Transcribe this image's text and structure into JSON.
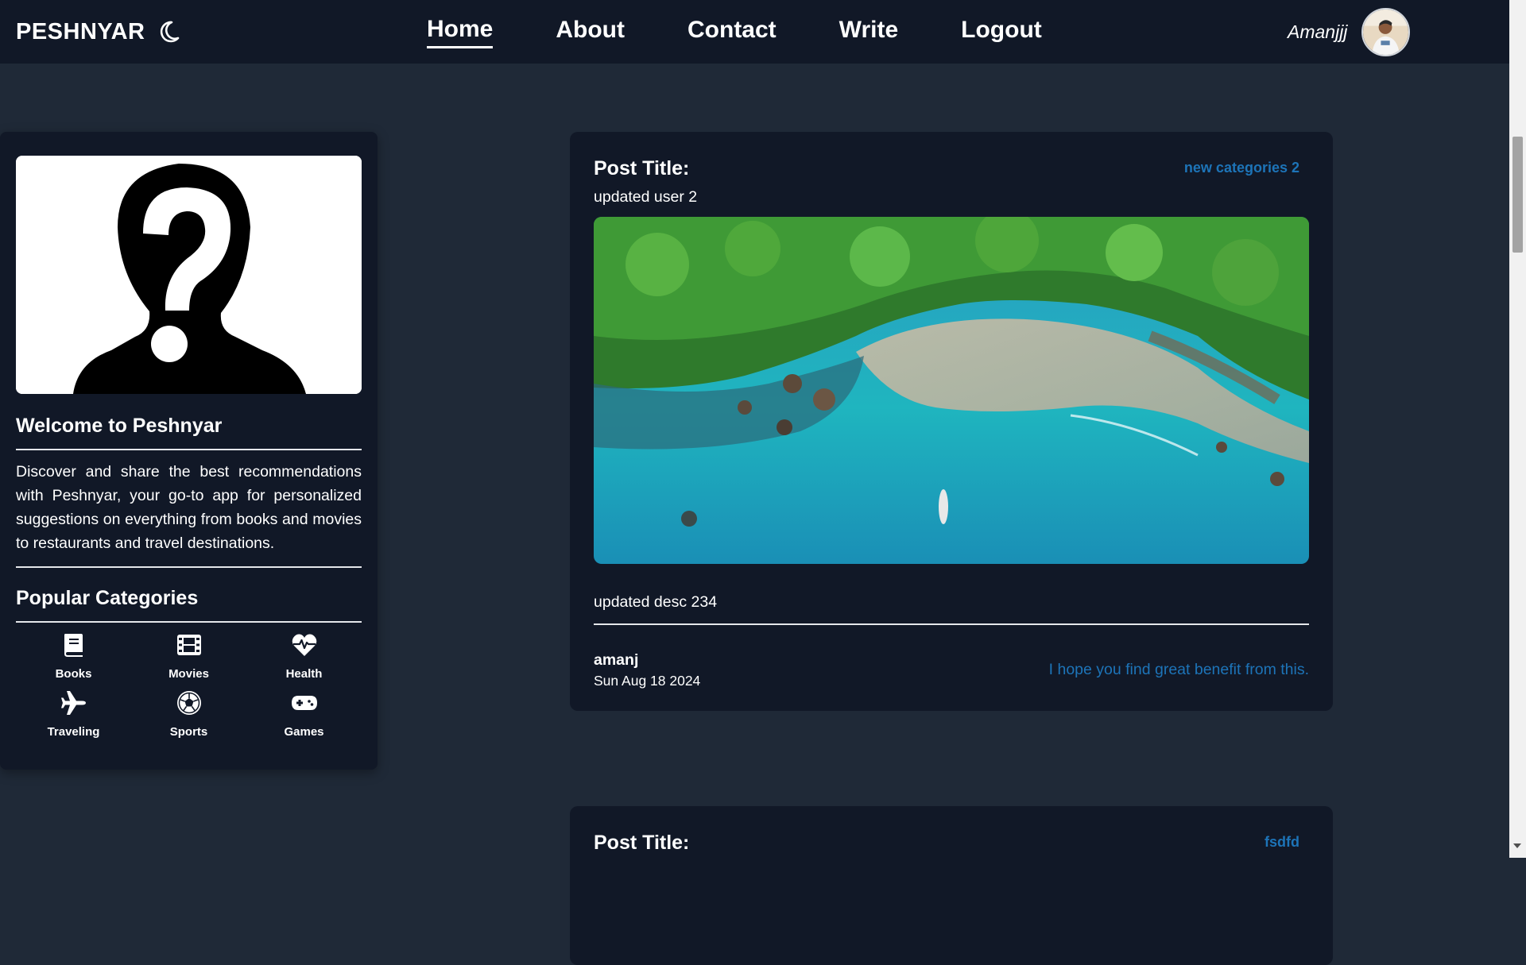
{
  "navbar": {
    "brand": "PESHNYAR",
    "theme_icon": "moon-icon",
    "links": [
      {
        "label": "Home",
        "active": true
      },
      {
        "label": "About",
        "active": false
      },
      {
        "label": "Contact",
        "active": false
      },
      {
        "label": "Write",
        "active": false
      },
      {
        "label": "Logout",
        "active": false
      }
    ],
    "username": "Amanjjj"
  },
  "sidebar": {
    "welcome_title": "Welcome to Peshnyar",
    "welcome_text": "Discover and share the best recommendations with Peshnyar, your go-to app for personalized suggestions on everything from books and movies to restaurants and travel destinations.",
    "categories_title": "Popular Categories",
    "categories": [
      {
        "label": "Books",
        "icon": "book-icon"
      },
      {
        "label": "Movies",
        "icon": "film-icon"
      },
      {
        "label": "Health",
        "icon": "heartbeat-icon"
      },
      {
        "label": "Traveling",
        "icon": "plane-icon"
      },
      {
        "label": "Sports",
        "icon": "soccer-ball-icon"
      },
      {
        "label": "Games",
        "icon": "gamepad-icon"
      }
    ]
  },
  "posts": [
    {
      "title_label": "Post Title:",
      "category": "new categories 2",
      "title": "updated user 2",
      "description": "updated desc 234",
      "author": "amanj",
      "date": "Sun Aug 18 2024",
      "quote": "I hope you find great benefit from this."
    },
    {
      "title_label": "Post Title:",
      "category": "fsdfd"
    }
  ],
  "colors": {
    "background": "#1f2937",
    "card": "#111827",
    "accent": "#1d74b8"
  }
}
